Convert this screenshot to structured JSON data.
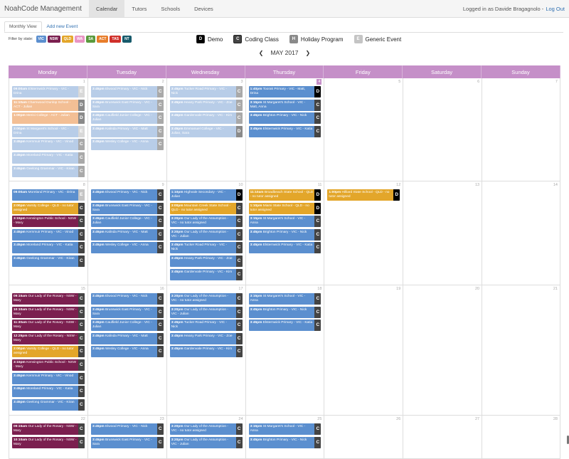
{
  "nav": {
    "brand": "NoahCode Management",
    "links": [
      "Calendar",
      "Tutors",
      "Schools",
      "Devices"
    ],
    "active": "Calendar",
    "logged_in": "Logged in as Davide Bragagnolo -",
    "logout": "Log Out"
  },
  "tabs": [
    "Monthly View",
    "Add new Event"
  ],
  "filter": {
    "label": "Filter by state:",
    "states": [
      {
        "code": "VIC",
        "color": "#5b8fcf"
      },
      {
        "code": "NSW",
        "color": "#7b1f4f"
      },
      {
        "code": "QLD",
        "color": "#e3a62a"
      },
      {
        "code": "WA",
        "color": "#e895c4"
      },
      {
        "code": "SA",
        "color": "#5a9a3d"
      },
      {
        "code": "ACT",
        "color": "#e87d2a"
      },
      {
        "code": "TAS",
        "color": "#d0302a"
      },
      {
        "code": "NT",
        "color": "#175a6b"
      }
    ]
  },
  "legend": [
    {
      "key": "D",
      "label": "Demo",
      "color": "#000000"
    },
    {
      "key": "C",
      "label": "Coding Class",
      "color": "#444444"
    },
    {
      "key": "H",
      "label": "Holiday Program",
      "color": "#8a8a8a"
    },
    {
      "key": "E",
      "label": "Generic Event",
      "color": "#c4c4c4"
    }
  ],
  "month": {
    "name": "MAY",
    "year": "2017"
  },
  "days_of_week": [
    "Monday",
    "Tuesday",
    "Wednesday",
    "Thursday",
    "Friday",
    "Saturday",
    "Sunday"
  ],
  "today": "4",
  "state_colors": {
    "VIC": "#5b8fcf",
    "VICp": "#b8cde8",
    "NSW": "#7b1f4f",
    "NSWp": "#c7a6b7",
    "QLD": "#e3a62a",
    "QLDp": "#f2d29a",
    "ACTp": "#f3bf95"
  },
  "type_colors": {
    "D": "#000000",
    "C": "#444444",
    "E": "#c4c4c4",
    "Dp": "#8a8a8a",
    "Cp": "#a9a9a9",
    "Ep": "#d8d8d8"
  },
  "weeks": [
    {
      "days": [
        "1",
        "2",
        "3",
        "4",
        "5",
        "6",
        "7"
      ],
      "events": [
        [
          {
            "time": "09:00am",
            "text": "Elsternwick Primary - VIC - Drina",
            "state": "VICp",
            "type": "Ep"
          },
          {
            "time": "11:10am",
            "text": "Charnwood Dunlop School - ACT - Julian",
            "state": "ACTp",
            "type": "Dp"
          },
          {
            "time": "1:00pm",
            "text": "Merici College - ACT - Julian",
            "state": "ACTp",
            "type": "Dp"
          },
          {
            "time": "3:00pm",
            "text": "St Margaret's School - VIC - Drina",
            "state": "VICp",
            "type": "Ep"
          },
          {
            "time": "3:45pm",
            "text": "Kernmuir Primary - VIC - Vinod",
            "state": "VICp",
            "type": "Cp"
          },
          {
            "time": "3:45pm",
            "text": "Moreland Primary - VIC - Katia",
            "state": "VICp",
            "type": "Cp"
          },
          {
            "time": "3:45pm",
            "text": "Geelong Grammar - VIC - Kiran",
            "state": "VICp",
            "type": "Cp"
          }
        ],
        [
          {
            "time": "3:45pm",
            "text": "Elwood Primary - VIC - Nick",
            "state": "VICp",
            "type": "Cp"
          },
          {
            "time": "3:45pm",
            "text": "Brunswick East Primary - VIC - Sara",
            "state": "VICp",
            "type": "Cp"
          },
          {
            "time": "3:45pm",
            "text": "Caulfield Junior College - VIC - Julian",
            "state": "VICp",
            "type": "Cp"
          },
          {
            "time": "3:45pm",
            "text": "Kalinda Primary - VIC - Matt",
            "state": "VICp",
            "type": "Cp"
          },
          {
            "time": "3:45pm",
            "text": "Wesley College - VIC - Anna",
            "state": "VICp",
            "type": "Cp"
          }
        ],
        [
          {
            "time": "3:45pm",
            "text": "Tucker Road Primary - VIC - Nick",
            "state": "VICp",
            "type": "Cp"
          },
          {
            "time": "3:45pm",
            "text": "Heany Park Primary - VIC - Zoe",
            "state": "VICp",
            "type": "Cp"
          },
          {
            "time": "3:45pm",
            "text": "Gardenvale Primary - VIC - Kim",
            "state": "VICp",
            "type": "Cp"
          },
          {
            "time": "3:45pm",
            "text": "Emmanuel College - VIC - Julian, Sara",
            "state": "VICp",
            "type": "Dp"
          }
        ],
        [
          {
            "time": "1:40pm",
            "text": "Toorak Primary - VIC - Matt, Drina",
            "state": "VIC",
            "type": "D"
          },
          {
            "time": "3:15pm",
            "text": "St Margaret's School - VIC - Matt, Anna",
            "state": "VIC",
            "type": "C"
          },
          {
            "time": "3:45pm",
            "text": "Brighton Primary - VIC - Nick",
            "state": "VIC",
            "type": "C"
          },
          {
            "time": "3:45pm",
            "text": "Elsternwick Primary - VIC - Katia",
            "state": "VIC",
            "type": "C"
          }
        ],
        [],
        [],
        []
      ]
    },
    {
      "days": [
        "8",
        "9",
        "10",
        "11",
        "12",
        "13",
        "14"
      ],
      "events": [
        [
          {
            "time": "09:00am",
            "text": "Moreland Primary - VIC - Drina",
            "state": "VIC",
            "type": "E"
          },
          {
            "time": "2:00pm",
            "text": "Varsity College - QLD - no tutor assigned",
            "state": "QLD",
            "type": "C"
          },
          {
            "time": "3:15pm",
            "text": "Kensington Public School - NSW - Mary",
            "state": "NSW",
            "type": "C"
          },
          {
            "time": "3:45pm",
            "text": "Kernmuir Primary - VIC - Vinod",
            "state": "VIC",
            "type": "C"
          },
          {
            "time": "3:45pm",
            "text": "Moreland Primary - VIC - Katia",
            "state": "VIC",
            "type": "C"
          },
          {
            "time": "3:45pm",
            "text": "Geelong Grammar - VIC - Kiran",
            "state": "VIC",
            "type": "C"
          }
        ],
        [
          {
            "time": "3:45pm",
            "text": "Elwood Primary - VIC - Nick",
            "state": "VIC",
            "type": "C"
          },
          {
            "time": "3:45pm",
            "text": "Brunswick East Primary - VIC - Sara",
            "state": "VIC",
            "type": "C"
          },
          {
            "time": "3:45pm",
            "text": "Caulfield Junior College - VIC - Julian",
            "state": "VIC",
            "type": "C"
          },
          {
            "time": "3:45pm",
            "text": "Kalinda Primary - VIC - Matt",
            "state": "VIC",
            "type": "C"
          },
          {
            "time": "3:45pm",
            "text": "Wesley College - VIC - Anna",
            "state": "VIC",
            "type": "C"
          }
        ],
        [
          {
            "time": "1:10pm",
            "text": "Highvale Secondary - VIC - Julian",
            "state": "VIC",
            "type": "D"
          },
          {
            "time": "3:00pm",
            "text": "Mountain Creek State School - QLD - no tutor assigned",
            "state": "QLD",
            "type": "C"
          },
          {
            "time": "3:20pm",
            "text": "Our Lady of the Assumption - VIC - no tutor assigned",
            "state": "VIC",
            "type": "C"
          },
          {
            "time": "3:20pm",
            "text": "Our Lady of the Assumption - VIC - Julian",
            "state": "VIC",
            "type": "C"
          },
          {
            "time": "3:45pm",
            "text": "Tucker Road Primary - VIC - Nick",
            "state": "VIC",
            "type": "C"
          },
          {
            "time": "3:45pm",
            "text": "Heany Park Primary - VIC - Zoe",
            "state": "VIC",
            "type": "C"
          },
          {
            "time": "3:45pm",
            "text": "Gardenvale Primary - VIC - Kim",
            "state": "VIC",
            "type": "C"
          }
        ],
        [
          {
            "time": "11:10am",
            "text": "Broadbeach State School - QLD - no tutor assigned",
            "state": "QLD",
            "type": "D"
          },
          {
            "time": "1:10pm",
            "text": "Miami State School - QLD - no tutor assigned",
            "state": "QLD",
            "type": "D"
          },
          {
            "time": "3:15pm",
            "text": "St Margaret's School - VIC - Anna",
            "state": "VIC",
            "type": "C"
          },
          {
            "time": "3:45pm",
            "text": "Brighton Primary - VIC - Nick",
            "state": "VIC",
            "type": "C"
          },
          {
            "time": "3:45pm",
            "text": "Elsternwick Primary - VIC - Katia",
            "state": "VIC",
            "type": "C"
          }
        ],
        [
          {
            "time": "1:00pm",
            "text": "Hilliard State School - QLD - no tutor assigned",
            "state": "QLD",
            "type": "D"
          }
        ],
        [],
        []
      ]
    },
    {
      "days": [
        "15",
        "16",
        "17",
        "18",
        "19",
        "20",
        "21"
      ],
      "events": [
        [
          {
            "time": "09:15am",
            "text": "Our Lady of the Rosary - NSW - Mary",
            "state": "NSW",
            "type": "C"
          },
          {
            "time": "10:10am",
            "text": "Our Lady of the Rosary - NSW - Mary",
            "state": "NSW",
            "type": "C"
          },
          {
            "time": "11:30am",
            "text": "Our Lady of the Rosary - NSW - Mary",
            "state": "NSW",
            "type": "C"
          },
          {
            "time": "12:25pm",
            "text": "Our Lady of the Rosary - NSW - Mary",
            "state": "NSW",
            "type": "C"
          },
          {
            "time": "2:00pm",
            "text": "Varsity College - QLD - no tutor assigned",
            "state": "QLD",
            "type": "C"
          },
          {
            "time": "3:15pm",
            "text": "Kensington Public School - NSW - Mary",
            "state": "NSW",
            "type": "C"
          },
          {
            "time": "3:45pm",
            "text": "Kernmuir Primary - VIC - Vinod",
            "state": "VIC",
            "type": "C"
          },
          {
            "time": "3:45pm",
            "text": "Moreland Primary - VIC - Katia",
            "state": "VIC",
            "type": "C"
          },
          {
            "time": "3:45pm",
            "text": "Geelong Grammar - VIC - Kiran",
            "state": "VIC",
            "type": "C"
          }
        ],
        [
          {
            "time": "3:45pm",
            "text": "Elwood Primary - VIC - Nick",
            "state": "VIC",
            "type": "C"
          },
          {
            "time": "3:45pm",
            "text": "Brunswick East Primary - VIC - Sara",
            "state": "VIC",
            "type": "C"
          },
          {
            "time": "3:45pm",
            "text": "Caulfield Junior College - VIC - Julian",
            "state": "VIC",
            "type": "C"
          },
          {
            "time": "3:45pm",
            "text": "Kalinda Primary - VIC - Matt",
            "state": "VIC",
            "type": "C"
          },
          {
            "time": "3:45pm",
            "text": "Wesley College - VIC - Anna",
            "state": "VIC",
            "type": "C"
          }
        ],
        [
          {
            "time": "3:20pm",
            "text": "Our Lady of the Assumption - VIC - no tutor assigned",
            "state": "VIC",
            "type": "C"
          },
          {
            "time": "3:20pm",
            "text": "Our Lady of the Assumption - VIC - Julian",
            "state": "VIC",
            "type": "C"
          },
          {
            "time": "3:45pm",
            "text": "Tucker Road Primary - VIC - Nick",
            "state": "VIC",
            "type": "C"
          },
          {
            "time": "3:45pm",
            "text": "Heany Park Primary - VIC - Zoe",
            "state": "VIC",
            "type": "C"
          },
          {
            "time": "3:45pm",
            "text": "Gardenvale Primary - VIC - Kim",
            "state": "VIC",
            "type": "C"
          }
        ],
        [
          {
            "time": "3:15pm",
            "text": "St Margaret's School - VIC - Anna",
            "state": "VIC",
            "type": "C"
          },
          {
            "time": "3:45pm",
            "text": "Brighton Primary - VIC - Nick",
            "state": "VIC",
            "type": "C"
          },
          {
            "time": "3:45pm",
            "text": "Elsternwick Primary - VIC - Katia",
            "state": "VIC",
            "type": "C"
          }
        ],
        [],
        [],
        []
      ]
    },
    {
      "days": [
        "22",
        "23",
        "24",
        "25",
        "26",
        "27",
        "28"
      ],
      "events": [
        [
          {
            "time": "09:15am",
            "text": "Our Lady of the Rosary - NSW - Mary",
            "state": "NSW",
            "type": "C"
          },
          {
            "time": "10:10am",
            "text": "Our Lady of the Rosary - NSW - Mary",
            "state": "NSW",
            "type": "C"
          }
        ],
        [
          {
            "time": "3:45pm",
            "text": "Elwood Primary - VIC - Nick",
            "state": "VIC",
            "type": "C"
          },
          {
            "time": "3:45pm",
            "text": "Brunswick East Primary - VIC - Sara",
            "state": "VIC",
            "type": "C"
          }
        ],
        [
          {
            "time": "3:20pm",
            "text": "Our Lady of the Assumption - VIC - no tutor assigned",
            "state": "VIC",
            "type": "C"
          },
          {
            "time": "3:20pm",
            "text": "Our Lady of the Assumption - VIC - Julian",
            "state": "VIC",
            "type": "C"
          }
        ],
        [
          {
            "time": "3:15pm",
            "text": "St Margaret's School - VIC - Anna",
            "state": "VIC",
            "type": "C"
          },
          {
            "time": "3:45pm",
            "text": "Brighton Primary - VIC - Nick",
            "state": "VIC",
            "type": "C"
          }
        ],
        [],
        [],
        []
      ]
    }
  ]
}
